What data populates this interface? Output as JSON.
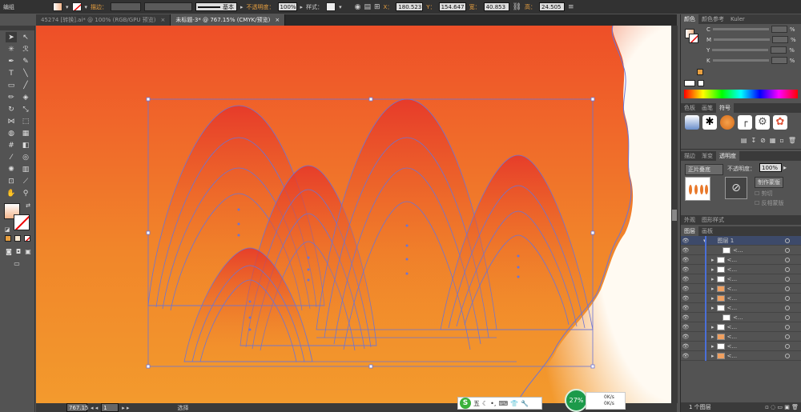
{
  "menubar": {
    "first": "编组"
  },
  "options": {
    "stroke_label": "描边：",
    "stroke_style": "基本",
    "opacity_label": "不透明度：",
    "opacity_value": "100%",
    "style_label": "样式：",
    "x_label": "X：",
    "x_value": "180.523",
    "y_label": "Y：",
    "y_value": "154.647",
    "w_label": "宽：",
    "w_value": "40.853",
    "h_label": "高：",
    "h_value": "24.505"
  },
  "tabs": [
    {
      "label": "45274 [转换].ai* @ 100% (RGB/GPU 预览)",
      "close": "×"
    },
    {
      "label": "未标题-3* @ 767.15% (CMYK/预览)",
      "close": "×"
    }
  ],
  "status": {
    "zoom": "767.15",
    "page": "1",
    "tool": "选择"
  },
  "color_panel": {
    "tabs": [
      "颜色",
      "颜色参考",
      "Kuler"
    ],
    "channels": [
      {
        "label": "C",
        "value": "%"
      },
      {
        "label": "M",
        "value": "%"
      },
      {
        "label": "Y",
        "value": "%"
      },
      {
        "label": "K",
        "value": "%"
      }
    ]
  },
  "swatch_panel": {
    "tabs": [
      "色板",
      "画笔",
      "符号"
    ]
  },
  "transparency_panel": {
    "tabs": [
      "描边",
      "渐变",
      "透明度"
    ],
    "blend_mode": "正片叠底",
    "opacity_label": "不透明度：",
    "opacity_value": "100%",
    "make_mask": "制作蒙版",
    "clip": "剪切",
    "invert": "反相蒙版"
  },
  "appearance_panel": {
    "tabs": [
      "外观",
      "图形样式"
    ]
  },
  "layers_panel": {
    "tabs": [
      "图层",
      "画板"
    ],
    "layer_name": "图层 1",
    "sublayer_label": "<...",
    "footer": "1 个图层"
  },
  "taskbar": {
    "ime": "五",
    "percent": "27%",
    "up": "0K/s",
    "down": "0K/s"
  },
  "colors": {
    "accent": "#e8a040",
    "artboard_top": "#ee4f28",
    "artboard_bottom": "#f39a2d",
    "path": "#6b74d6"
  }
}
